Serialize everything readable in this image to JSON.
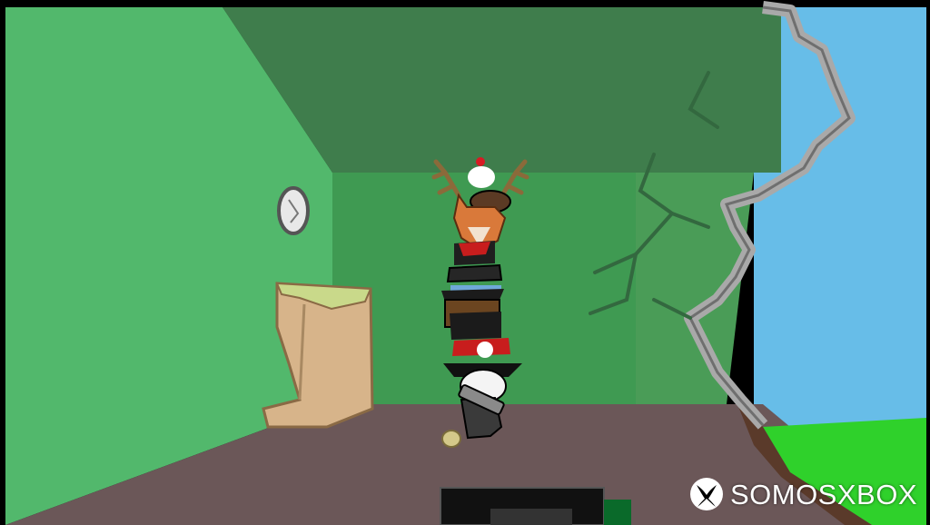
{
  "watermark": {
    "text": "SOMOSXBOX",
    "logo_icon": "xbox-logo-icon",
    "color": "#ffffff"
  },
  "scene": {
    "colors": {
      "left_wall": "#52b86c",
      "ceiling": "#3f7d4c",
      "back_wall": "#3f9a52",
      "right_wall": "#4a9c57",
      "floor": "#6b5758",
      "sky": "#67bde8",
      "grass": "#2fd12b",
      "rock": "#a9a9a9",
      "frame": "#000000"
    }
  }
}
